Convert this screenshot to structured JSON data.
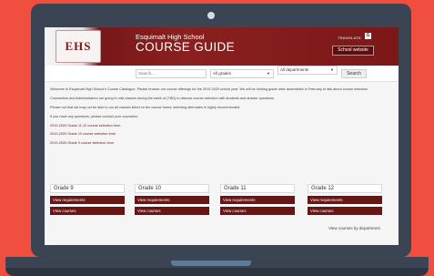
{
  "header": {
    "school_name": "Esquimalt High School",
    "title": "COURSE GUIDE",
    "logo_text": "EHS",
    "translate_label": "TRANSLATE",
    "translate_icon": "G",
    "school_website_label": "School website"
  },
  "search": {
    "placeholder": "Search...",
    "grades_select": "All grades",
    "departments_select": "All departments",
    "button_label": "Search"
  },
  "intro": {
    "paragraph1": "Welcome to Esquimalt High School's Course Catalogue. Please browse our course offerings for the 2019-2020 school year. We will be holding grade wide assemblies in February to talk about course selection.",
    "paragraph2": "Counsellors and Administrators are going to visit classes during the week of (TBD) to discuss course selection with students and answer questions.",
    "paragraph3": "Please not that we may not be able to run all classes listed on the course forms; selecting alternates is highly recommended.",
    "paragraph4": "If you have any questions, please contact your counsellor.",
    "links": [
      "2019-2020 Grade 11-12 course selection form",
      "2019-2020 Grade 10 course selection form",
      "2019-2020 Grade 9 course selection form"
    ]
  },
  "grades": [
    {
      "title": "Grade 9",
      "requirements_label": "View requirements",
      "courses_label": "View courses"
    },
    {
      "title": "Grade 10",
      "requirements_label": "View requirements",
      "courses_label": "View courses"
    },
    {
      "title": "Grade 11",
      "requirements_label": "View requirements",
      "courses_label": "View courses"
    },
    {
      "title": "Grade 12",
      "requirements_label": "View requirements",
      "courses_label": "View courses"
    }
  ],
  "footer": {
    "department_link": "View courses by department"
  },
  "colors": {
    "background": "#f04e3e",
    "laptop": "#3a4452",
    "brand": "#6b1414"
  }
}
